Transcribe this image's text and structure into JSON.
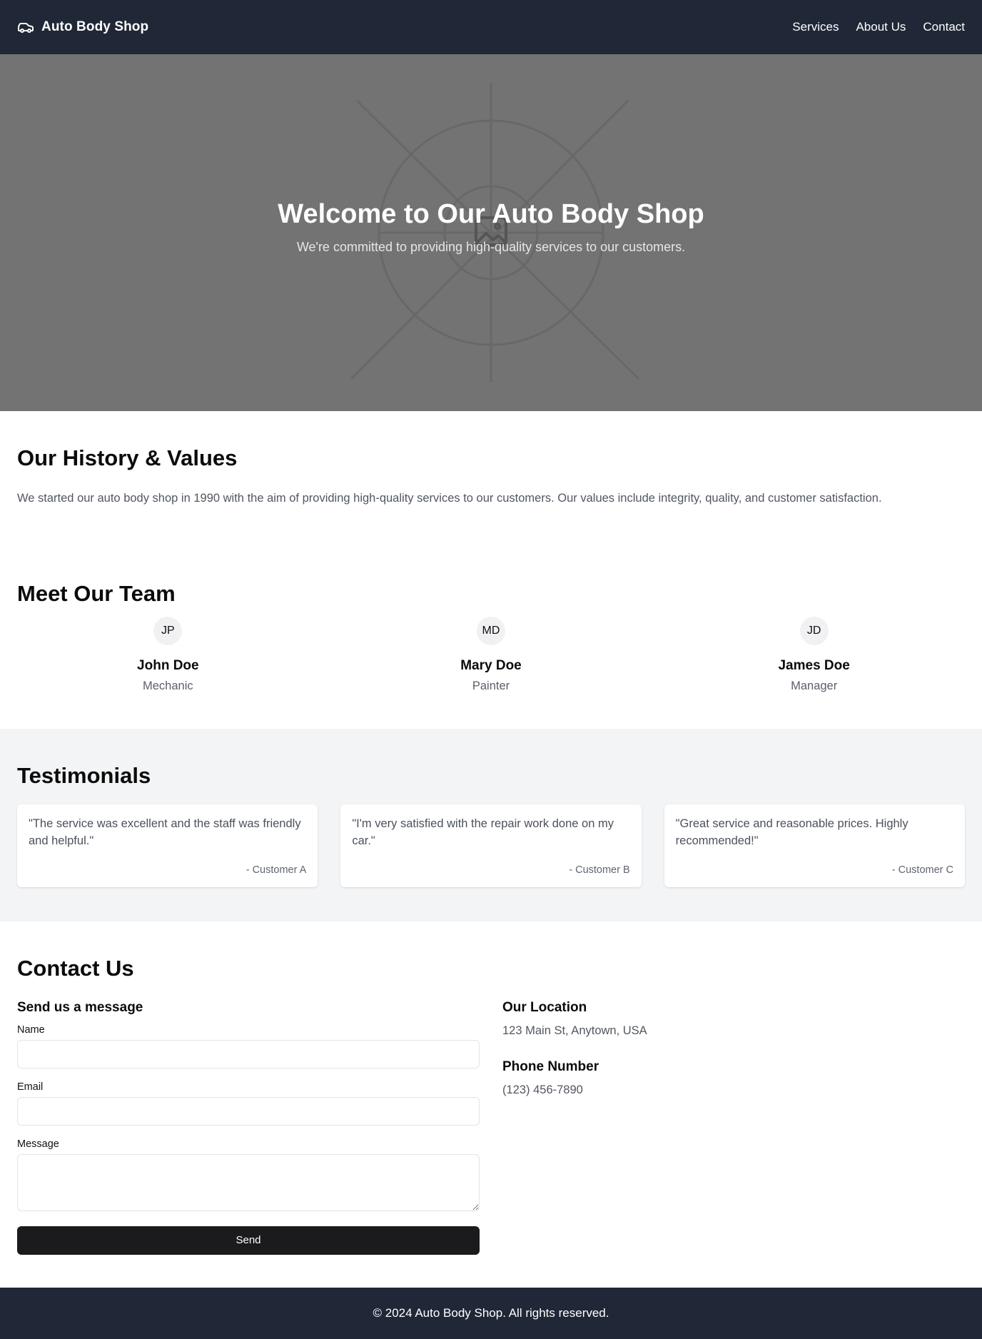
{
  "header": {
    "brand": "Auto Body Shop",
    "brand_icon": "car-icon",
    "nav": [
      "Services",
      "About Us",
      "Contact"
    ]
  },
  "hero": {
    "title": "Welcome to Our Auto Body Shop",
    "subtitle": "We're committed to providing high-quality services to our customers.",
    "background_icon": "image-placeholder-icon"
  },
  "history": {
    "title": "Our History & Values",
    "text": "We started our auto body shop in 1990 with the aim of providing high-quality services to our customers. Our values include integrity, quality, and customer satisfaction."
  },
  "team": {
    "title": "Meet Our Team",
    "members": [
      {
        "initials": "JP",
        "name": "John Doe",
        "role": "Mechanic"
      },
      {
        "initials": "MD",
        "name": "Mary Doe",
        "role": "Painter"
      },
      {
        "initials": "JD",
        "name": "James Doe",
        "role": "Manager"
      }
    ]
  },
  "testimonials": {
    "title": "Testimonials",
    "items": [
      {
        "quote": "\"The service was excellent and the staff was friendly and helpful.\"",
        "author": "- Customer A"
      },
      {
        "quote": "\"I'm very satisfied with the repair work done on my car.\"",
        "author": "- Customer B"
      },
      {
        "quote": "\"Great service and reasonable prices. Highly recommended!\"",
        "author": "- Customer C"
      }
    ]
  },
  "contact": {
    "title": "Contact Us",
    "form_title": "Send us a message",
    "name_label": "Name",
    "name_value": "",
    "email_label": "Email",
    "email_value": "",
    "message_label": "Message",
    "message_value": "",
    "send_label": "Send",
    "location_title": "Our Location",
    "location": "123 Main St, Anytown, USA",
    "phone_title": "Phone Number",
    "phone": "(123) 456-7890"
  },
  "footer": {
    "text": "© 2024 Auto Body Shop. All rights reserved."
  },
  "colors": {
    "header_bg": "#202837",
    "hero_bg": "#737373",
    "testimonials_bg": "#f3f4f6",
    "button_bg": "#1b1b1d"
  }
}
